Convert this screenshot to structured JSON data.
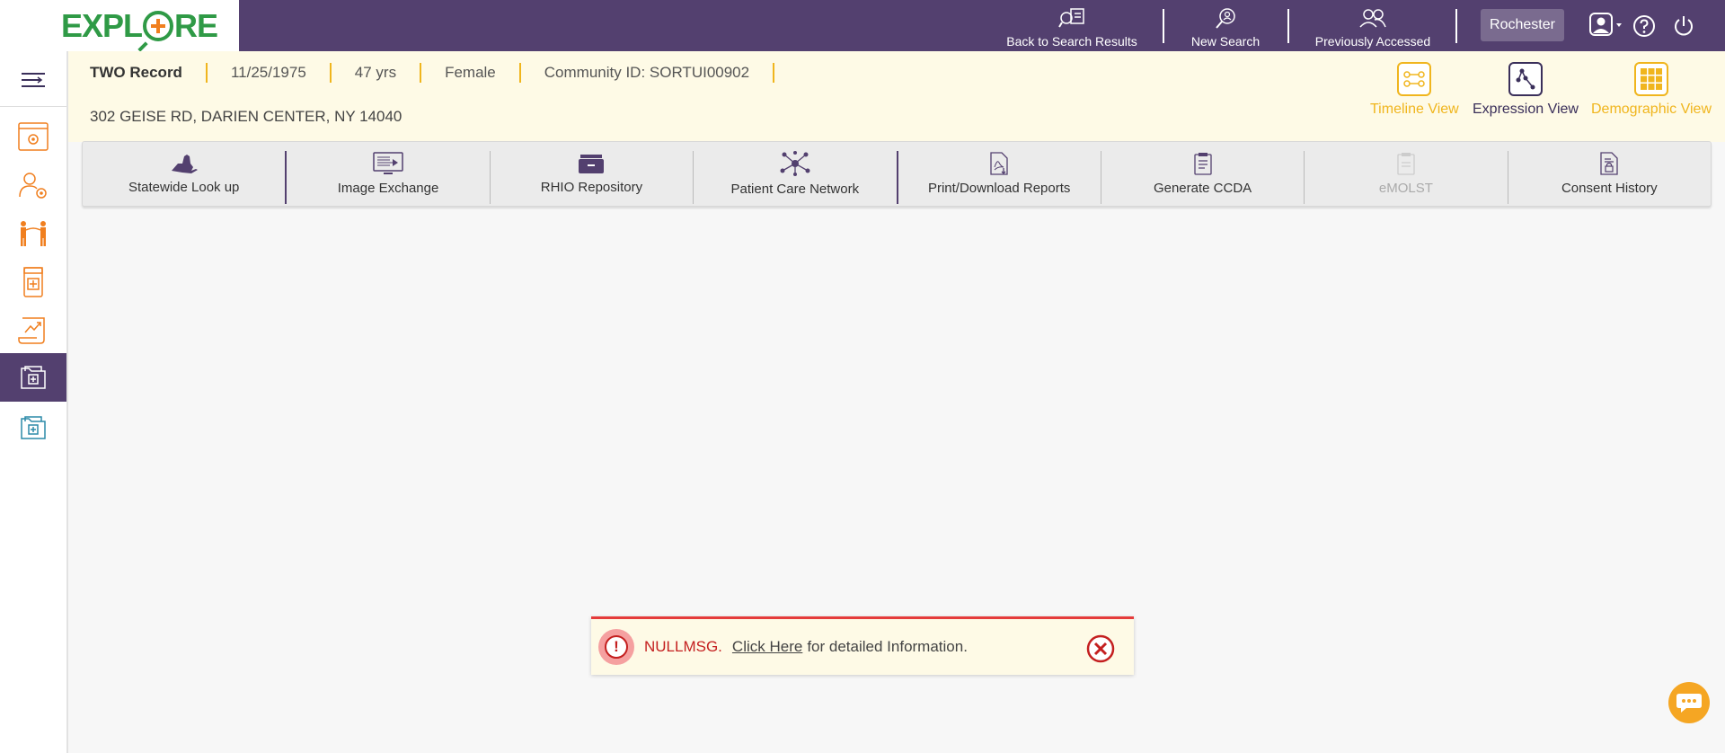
{
  "app": {
    "logo_text": "EXPLORE"
  },
  "topnav": {
    "back_label": "Back to Search Results",
    "new_search_label": "New Search",
    "previously_accessed_label": "Previously Accessed",
    "location": "Rochester"
  },
  "patient": {
    "record": "TWO Record",
    "dob": "11/25/1975",
    "age": "47 yrs",
    "gender": "Female",
    "community_id": "Community ID: SORTUI00902",
    "address": "302 GEISE RD, DARIEN CENTER, NY 14040"
  },
  "views": {
    "timeline": "Timeline View",
    "expression": "Expression View",
    "demographic": "Demographic View"
  },
  "toolbar": {
    "items": [
      {
        "label": "Statewide Look up",
        "icon": "ny-state-icon"
      },
      {
        "label": "Image Exchange",
        "icon": "monitor-icon"
      },
      {
        "label": "RHIO Repository",
        "icon": "archive-box-icon"
      },
      {
        "label": "Patient Care Network",
        "icon": "network-icon"
      },
      {
        "label": "Print/Download Reports",
        "icon": "pdf-download-icon"
      },
      {
        "label": "Generate CCDA",
        "icon": "ccda-document-icon"
      },
      {
        "label": "eMOLST",
        "icon": "emolst-document-icon"
      },
      {
        "label": "Consent History",
        "icon": "consent-document-icon"
      }
    ]
  },
  "alert": {
    "message": "NULLMSG.",
    "link": "Click Here",
    "rest": "for detailed Information."
  },
  "colors": {
    "brand_purple": "#53406f",
    "accent_orange": "#f0b51d",
    "alert_red": "#c41f1f",
    "header_bg": "#fefae6"
  }
}
